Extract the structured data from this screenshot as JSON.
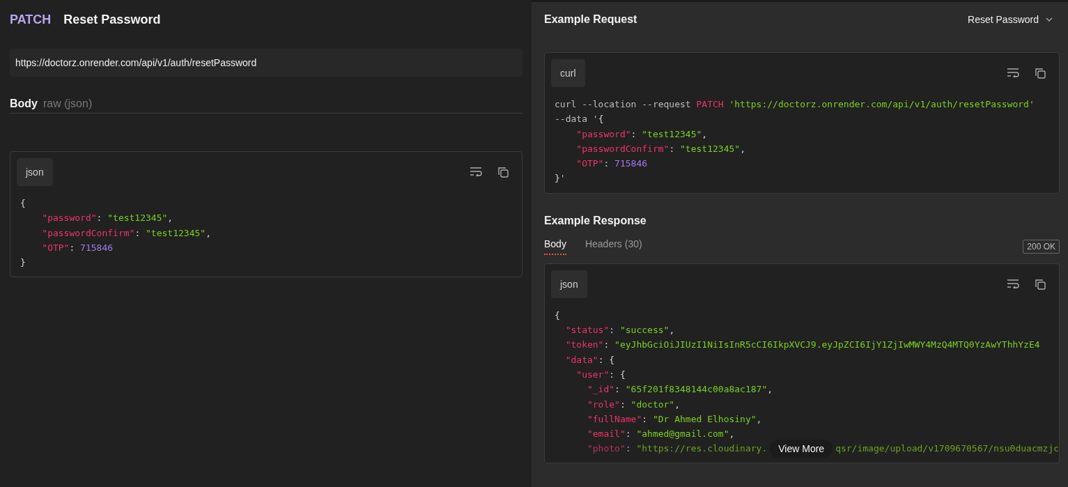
{
  "request": {
    "method": "PATCH",
    "name": "Reset Password",
    "url": "https://doctorz.onrender.com/api/v1/auth/resetPassword",
    "body_label": "Body",
    "body_type": "raw (json)",
    "code": {
      "language": "json",
      "lines": [
        [
          {
            "kind": "punct",
            "text": "{"
          }
        ],
        [
          {
            "kind": "key",
            "text": "    \"password\""
          },
          {
            "kind": "punct",
            "text": ": "
          },
          {
            "kind": "string",
            "text": "\"test12345\""
          },
          {
            "kind": "punct",
            "text": ","
          }
        ],
        [
          {
            "kind": "key",
            "text": "    \"passwordConfirm\""
          },
          {
            "kind": "punct",
            "text": ": "
          },
          {
            "kind": "string",
            "text": "\"test12345\""
          },
          {
            "kind": "punct",
            "text": ","
          }
        ],
        [
          {
            "kind": "key",
            "text": "    \"OTP\""
          },
          {
            "kind": "punct",
            "text": ": "
          },
          {
            "kind": "number",
            "text": "715846"
          }
        ],
        [
          {
            "kind": "punct",
            "text": "}"
          }
        ]
      ]
    }
  },
  "example_request": {
    "title": "Example Request",
    "selector": "Reset Password",
    "code": {
      "language": "curl",
      "lines": [
        [
          {
            "kind": "plain",
            "text": "curl --location --request "
          },
          {
            "kind": "key",
            "text": "PATCH"
          },
          {
            "kind": "string",
            "text": " 'https://doctorz.onrender.com/api/v1/auth/resetPassword'"
          }
        ],
        [
          {
            "kind": "plain",
            "text": "--data '"
          },
          {
            "kind": "punct",
            "text": "{"
          }
        ],
        [
          {
            "kind": "key",
            "text": "    \"password\""
          },
          {
            "kind": "punct",
            "text": ": "
          },
          {
            "kind": "string",
            "text": "\"test12345\""
          },
          {
            "kind": "punct",
            "text": ","
          }
        ],
        [
          {
            "kind": "key",
            "text": "    \"passwordConfirm\""
          },
          {
            "kind": "punct",
            "text": ": "
          },
          {
            "kind": "string",
            "text": "\"test12345\""
          },
          {
            "kind": "punct",
            "text": ","
          }
        ],
        [
          {
            "kind": "key",
            "text": "    \"OTP\""
          },
          {
            "kind": "punct",
            "text": ": "
          },
          {
            "kind": "number",
            "text": "715846"
          }
        ],
        [
          {
            "kind": "punct",
            "text": "}"
          },
          {
            "kind": "plain",
            "text": "'"
          }
        ]
      ]
    }
  },
  "example_response": {
    "title": "Example Response",
    "tabs": [
      {
        "label": "Body",
        "selected": true
      },
      {
        "label": "Headers (30)",
        "selected": false
      }
    ],
    "status": "200 OK",
    "code": {
      "language": "json",
      "lines": [
        [
          {
            "kind": "punct",
            "text": "{"
          }
        ],
        [
          {
            "kind": "key",
            "text": "  \"status\""
          },
          {
            "kind": "punct",
            "text": ": "
          },
          {
            "kind": "string",
            "text": "\"success\""
          },
          {
            "kind": "punct",
            "text": ","
          }
        ],
        [
          {
            "kind": "key",
            "text": "  \"token\""
          },
          {
            "kind": "punct",
            "text": ": "
          },
          {
            "kind": "string",
            "text": "\"eyJhbGciOiJIUzI1NiIsInR5cCI6IkpXVCJ9.eyJpZCI6IjY1ZjIwMWY4MzQ4MTQ0YzAwYThhYzE4"
          }
        ],
        [
          {
            "kind": "key",
            "text": "  \"data\""
          },
          {
            "kind": "punct",
            "text": ": {"
          }
        ],
        [
          {
            "kind": "key",
            "text": "    \"user\""
          },
          {
            "kind": "punct",
            "text": ": {"
          }
        ],
        [
          {
            "kind": "key",
            "text": "      \"_id\""
          },
          {
            "kind": "punct",
            "text": ": "
          },
          {
            "kind": "string",
            "text": "\"65f201f8348144c00a8ac187\""
          },
          {
            "kind": "punct",
            "text": ","
          }
        ],
        [
          {
            "kind": "key",
            "text": "      \"role\""
          },
          {
            "kind": "punct",
            "text": ": "
          },
          {
            "kind": "string",
            "text": "\"doctor\""
          },
          {
            "kind": "punct",
            "text": ","
          }
        ],
        [
          {
            "kind": "key",
            "text": "      \"fullName\""
          },
          {
            "kind": "punct",
            "text": ": "
          },
          {
            "kind": "string",
            "text": "\"Dr Ahmed Elhosiny\""
          },
          {
            "kind": "punct",
            "text": ","
          }
        ],
        [
          {
            "kind": "key",
            "text": "      \"email\""
          },
          {
            "kind": "punct",
            "text": ": "
          },
          {
            "kind": "string",
            "text": "\"ahmed@gmail.com\""
          },
          {
            "kind": "punct",
            "text": ","
          }
        ]
      ],
      "tail_parts": [
        [
          {
            "kind": "key",
            "text": "      \"photo\""
          },
          {
            "kind": "punct",
            "text": ": "
          },
          {
            "kind": "string",
            "text": "\"https://res.cloudinary."
          }
        ],
        [
          {
            "kind": "string",
            "text": "qsr/image/upload/v1709670567/nsu0duacmzjc"
          }
        ]
      ]
    },
    "view_more": "View More"
  }
}
